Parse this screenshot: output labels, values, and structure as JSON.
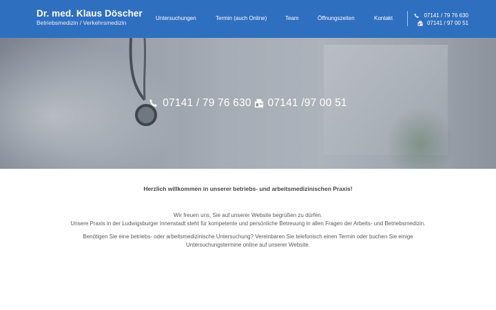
{
  "header": {
    "brand_name": "Dr. med. Klaus Döscher",
    "brand_sub": "Betriebsmedizin / Verkehrsmedizin",
    "nav": [
      {
        "label": "Untersuchungen"
      },
      {
        "label": "Termin (auch Online)"
      },
      {
        "label": "Team"
      },
      {
        "label": "Öffnungszeiten"
      },
      {
        "label": "Kontakt"
      }
    ],
    "phone": "07141 / 79 76 630",
    "fax": "07141 / 97 00 51"
  },
  "hero": {
    "phone": "07141 / 79 76 630",
    "fax": "07141 /97 00 51"
  },
  "content": {
    "welcome": "Herzlich willkommen in unserer betriebs- und arbeitsmedizinischen Praxis!",
    "line1": "Wir freuen uns, Sie auf unserer Website begrüßen zu dürfen.",
    "line2": "Unsere Praxis in der Ludwigsburger Innenstadt steht für kompetente und persönliche Betreuung in allen Fragen der Arbeits- und Betriebsmedizin.",
    "line3": "Benötigen Sie eine betriebs- oder arbeitsmedizinische Untersuchung? Vereinbaren Sie telefonisch einen Termin oder buchen Sie einige Untersuchungstermine online auf unserer Website."
  },
  "colors": {
    "header_bg": "#2f6fc0",
    "text": "#555555"
  },
  "icons": [
    "phone-icon",
    "fax-icon"
  ]
}
